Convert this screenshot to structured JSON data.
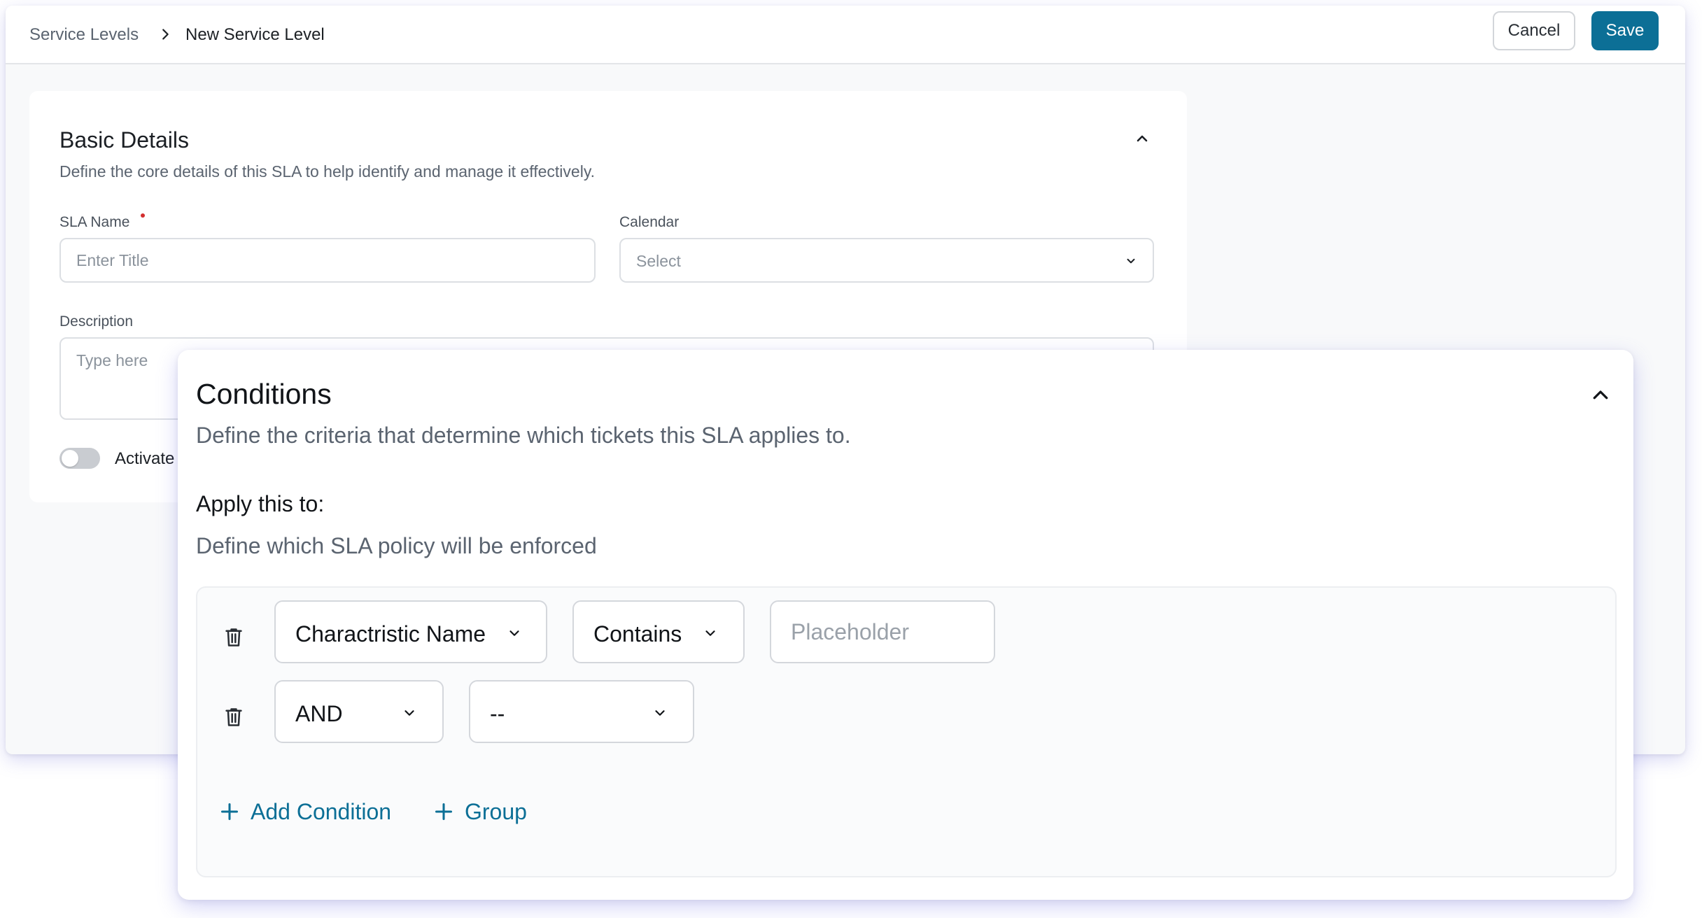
{
  "header": {
    "breadcrumb_parent": "Service Levels",
    "breadcrumb_current": "New Service Level",
    "cancel_label": "Cancel",
    "save_label": "Save"
  },
  "basic_details": {
    "title": "Basic Details",
    "subtitle": "Define the core details of this SLA to help identify and manage it effectively.",
    "sla_name_label": "SLA Name",
    "sla_name_placeholder": "Enter Title",
    "calendar_label": "Calendar",
    "calendar_value": "Select",
    "description_label": "Description",
    "description_placeholder": "Type here",
    "activate_label": "Activate",
    "activate_on": false
  },
  "conditions": {
    "title": "Conditions",
    "subtitle": "Define the criteria that determine which tickets this SLA applies to.",
    "apply_title": "Apply this to:",
    "apply_subtitle": "Define which SLA policy will be enforced",
    "rows": [
      {
        "field": "Charactristic Name",
        "operator": "Contains",
        "value_placeholder": "Placeholder"
      },
      {
        "logic": "AND",
        "value": "--"
      }
    ],
    "add_condition_label": "Add Condition",
    "group_label": "Group"
  },
  "colors": {
    "accent": "#0c6f96",
    "required": "#d32f2f"
  }
}
